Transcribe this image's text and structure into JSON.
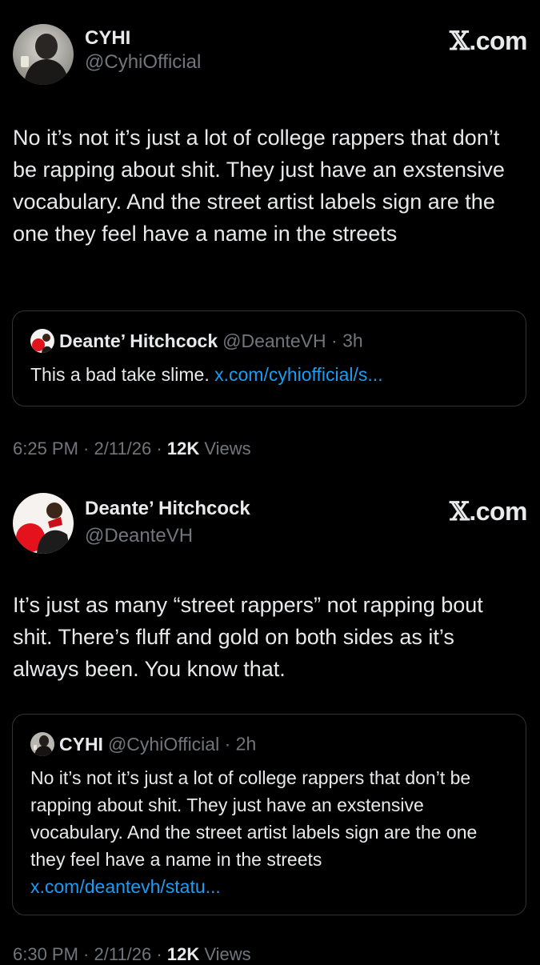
{
  "brand": {
    "x_glyph": "𝕏",
    "suffix": ".com"
  },
  "posts": [
    {
      "author": {
        "name": "CYHI",
        "handle": "@CyhiOfficial"
      },
      "text": "No it’s not it’s just a lot of college rappers that don’t be rapping about shit. They just have an exstensive vocabulary. And the street artist labels sign are the one they feel have a name in the streets",
      "quote": {
        "name": "Deante’ Hitchcock",
        "handle": "@DeanteVH",
        "dot": " · ",
        "time": "3h",
        "text": "This a bad take slime. ",
        "link": "x.com/cyhiofficial/s..."
      },
      "meta": {
        "time": "6:25 PM",
        "sep1": " · ",
        "date": "2/11/26",
        "sep2": " · ",
        "views_count": "12K",
        "views_label": " Views"
      }
    },
    {
      "author": {
        "name": "Deante’ Hitchcock",
        "handle": "@DeanteVH"
      },
      "text": "It’s just as many “street rappers” not rapping bout shit. There’s fluff and gold on both sides as it’s always been. You know that.",
      "quote": {
        "name": "CYHI",
        "handle": "@CyhiOfficial",
        "dot": " · ",
        "time": "2h",
        "text": "No it’s not it’s just a lot of college rappers that don’t be rapping about shit. They just have an exstensive vocabulary. And the street artist labels sign are the one they feel have a name in the streets ",
        "link": "x.com/deantevh/statu..."
      },
      "meta": {
        "time": "6:30 PM",
        "sep1": " · ",
        "date": "2/11/26",
        "sep2": " · ",
        "views_count": "12K",
        "views_label": " Views"
      }
    }
  ],
  "icons": {
    "avatar_cyhi": "avatar-photo-cyhi",
    "avatar_deante": "avatar-photo-deante"
  }
}
